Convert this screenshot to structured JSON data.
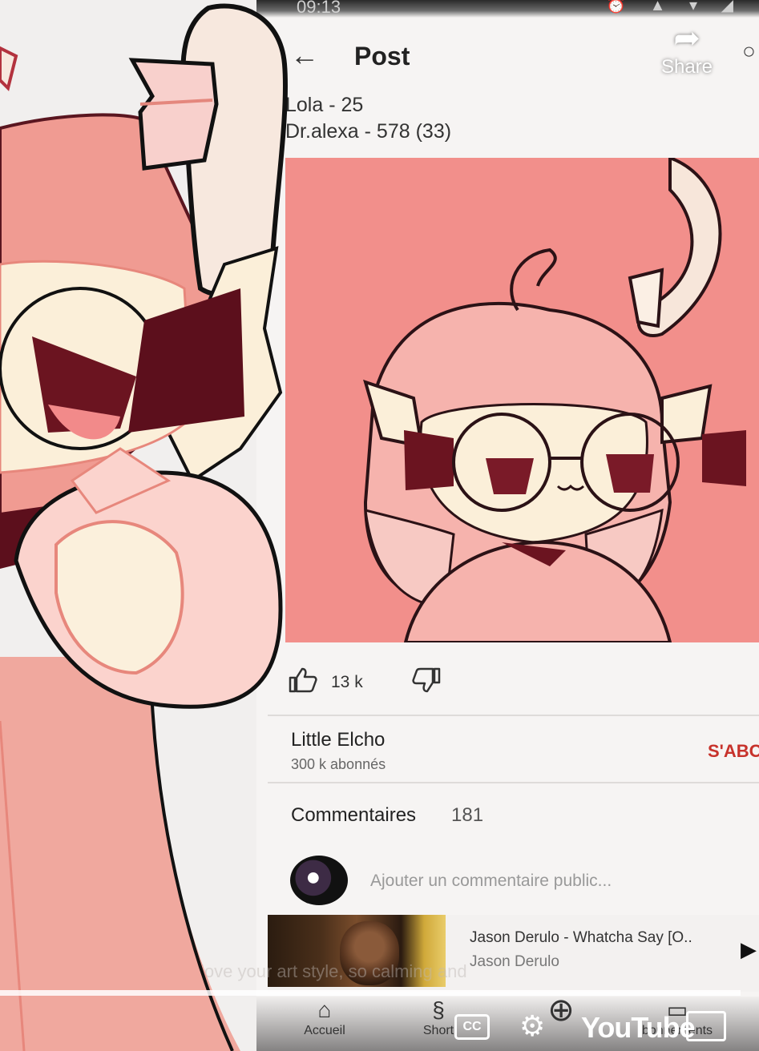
{
  "status_bar": {
    "time": "09:13",
    "icons": "⏰ ▲ ▾ ◢"
  },
  "header": {
    "title": "Post",
    "back_icon": "arrow-left-icon",
    "share_label": "Share",
    "search_icon": "search-icon"
  },
  "post": {
    "lines": [
      "Lola - 25",
      "Dr.alexa - 578 (33)"
    ],
    "likes": "13 k",
    "background_color": "#f28f8b"
  },
  "channel": {
    "name": "Little Elcho",
    "subscribers": "300 k abonnés",
    "subscribe_label": "S'ABO"
  },
  "comments": {
    "title": "Commentaires",
    "count": "181",
    "placeholder": "Ajouter un commentaire public..."
  },
  "mini_player": {
    "title": "Jason Derulo - Whatcha Say [O..",
    "artist": "Jason Derulo",
    "overlay_text": "love your art style, so calming and"
  },
  "nav": {
    "home": "Accueil",
    "shorts": "Short",
    "subscriptions": "bonnements"
  },
  "player": {
    "cc_label": "CC",
    "logo": "YouTube"
  },
  "colors": {
    "accent": "#c7322b",
    "character_pink": "#f2a39b",
    "character_cream": "#fbefd9",
    "character_dark": "#6b1420"
  }
}
